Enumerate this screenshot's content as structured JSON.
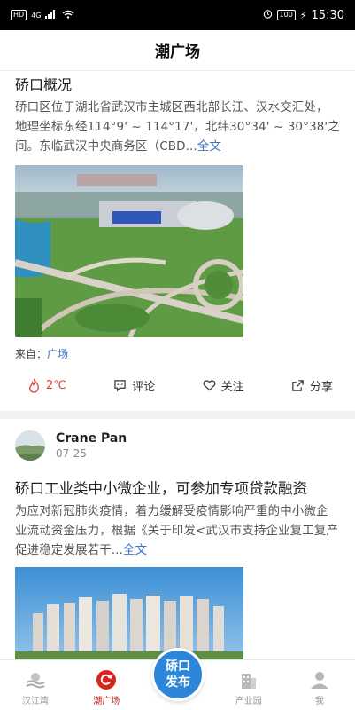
{
  "status_bar": {
    "left_badge": "HD",
    "network": "4G",
    "battery": "100",
    "time": "15:30"
  },
  "header": {
    "title": "潮广场"
  },
  "posts": [
    {
      "title": "硚口概况",
      "excerpt": "硚口区位于湖北省武汉市主城区西北部长江、汉水交汇处，地理坐标东经114°9' ~ 114°17'，北纬30°34' ~ 30°38'之间。东临武汉中央商务区（CBD...",
      "more": "全文",
      "source_label": "来自：",
      "source_link": "广场",
      "actions": {
        "hot": "2℃",
        "comment": "评论",
        "follow": "关注",
        "share": "分享"
      }
    },
    {
      "author": "Crane Pan",
      "date": "07-25",
      "title": "硚口工业类中小微企业，可参加专项贷款融资",
      "excerpt": "为应对新冠肺炎疫情，着力缓解受疫情影响严重的中小微企业流动资金压力，根据《关于印发<武汉市支持企业复工复产促进稳定发展若干...",
      "more": "全文"
    }
  ],
  "tabs": [
    {
      "label": "汉江湾",
      "icon": "river-bay-icon"
    },
    {
      "label": "潮广场",
      "icon": "refresh-circle-icon",
      "active": true
    },
    {
      "label": "硚口发布",
      "icon": "publish-button"
    },
    {
      "label": "产业园",
      "icon": "building-icon"
    },
    {
      "label": "我",
      "icon": "user-icon"
    }
  ],
  "colors": {
    "accent_red": "#c6261f",
    "link_blue": "#3f72c7",
    "fab_blue": "#2e86da"
  }
}
